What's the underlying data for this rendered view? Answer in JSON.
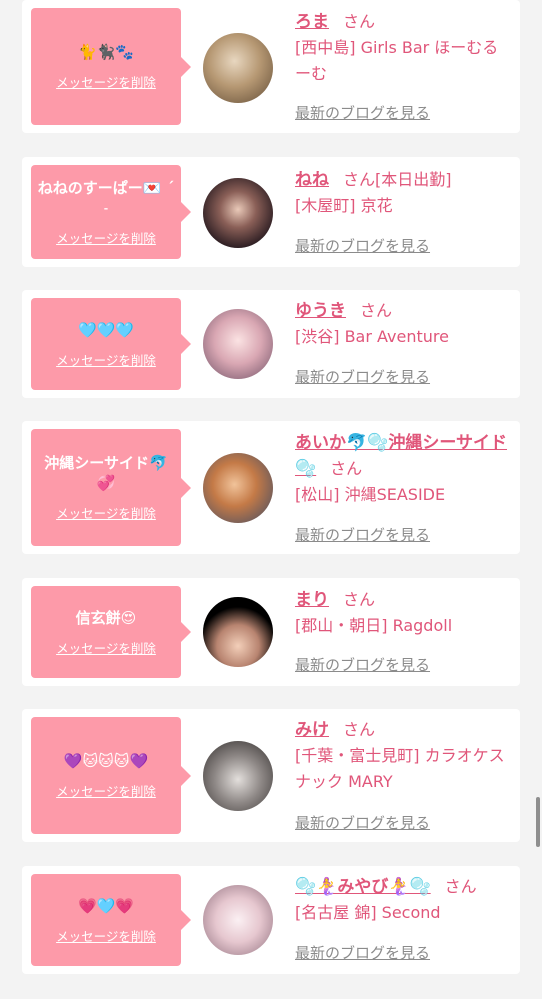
{
  "delete_label": "メッセージを削除",
  "blog_label": "最新のブログを見る",
  "san_label": "さん",
  "cards": [
    {
      "message": "🐈🐈‍⬛🐾",
      "name": "ろま",
      "name_suffix": "",
      "shop": "[西中島] Girls Bar ほーむるーむ"
    },
    {
      "message": "ねねのすーぱー💌 ˊ˗",
      "name": "ねね",
      "name_suffix": "[本日出勤]",
      "shop": "[木屋町] 京花"
    },
    {
      "message": "🩵🩵🩵",
      "name": "ゆうき",
      "name_suffix": "",
      "shop": "[渋谷] Bar Aventure"
    },
    {
      "message": "沖縄シーサイド🐬💞",
      "name": "あいか🐬🫧沖縄シーサイド🫧",
      "name_suffix": "",
      "shop": "[松山] 沖縄SEASIDE"
    },
    {
      "message": "信玄餅😍",
      "name": "まり",
      "name_suffix": "",
      "shop": "[郡山・朝日] Ragdoll"
    },
    {
      "message": "💜🐱🐱🐱💜",
      "name": "みけ",
      "name_suffix": "",
      "shop": "[千葉・富士見町] カラオケスナック MARY"
    },
    {
      "message": "💗🩵💗",
      "name": "🫧🧜‍♀️みやび🧜‍♀️🫧",
      "name_suffix": "",
      "shop": "[名古屋 錦] Second"
    }
  ],
  "colors": {
    "bubble": "#fd9aa9",
    "accent": "#e0567a",
    "link_gray": "#8b8b8b",
    "background": "#f3f3f3"
  }
}
